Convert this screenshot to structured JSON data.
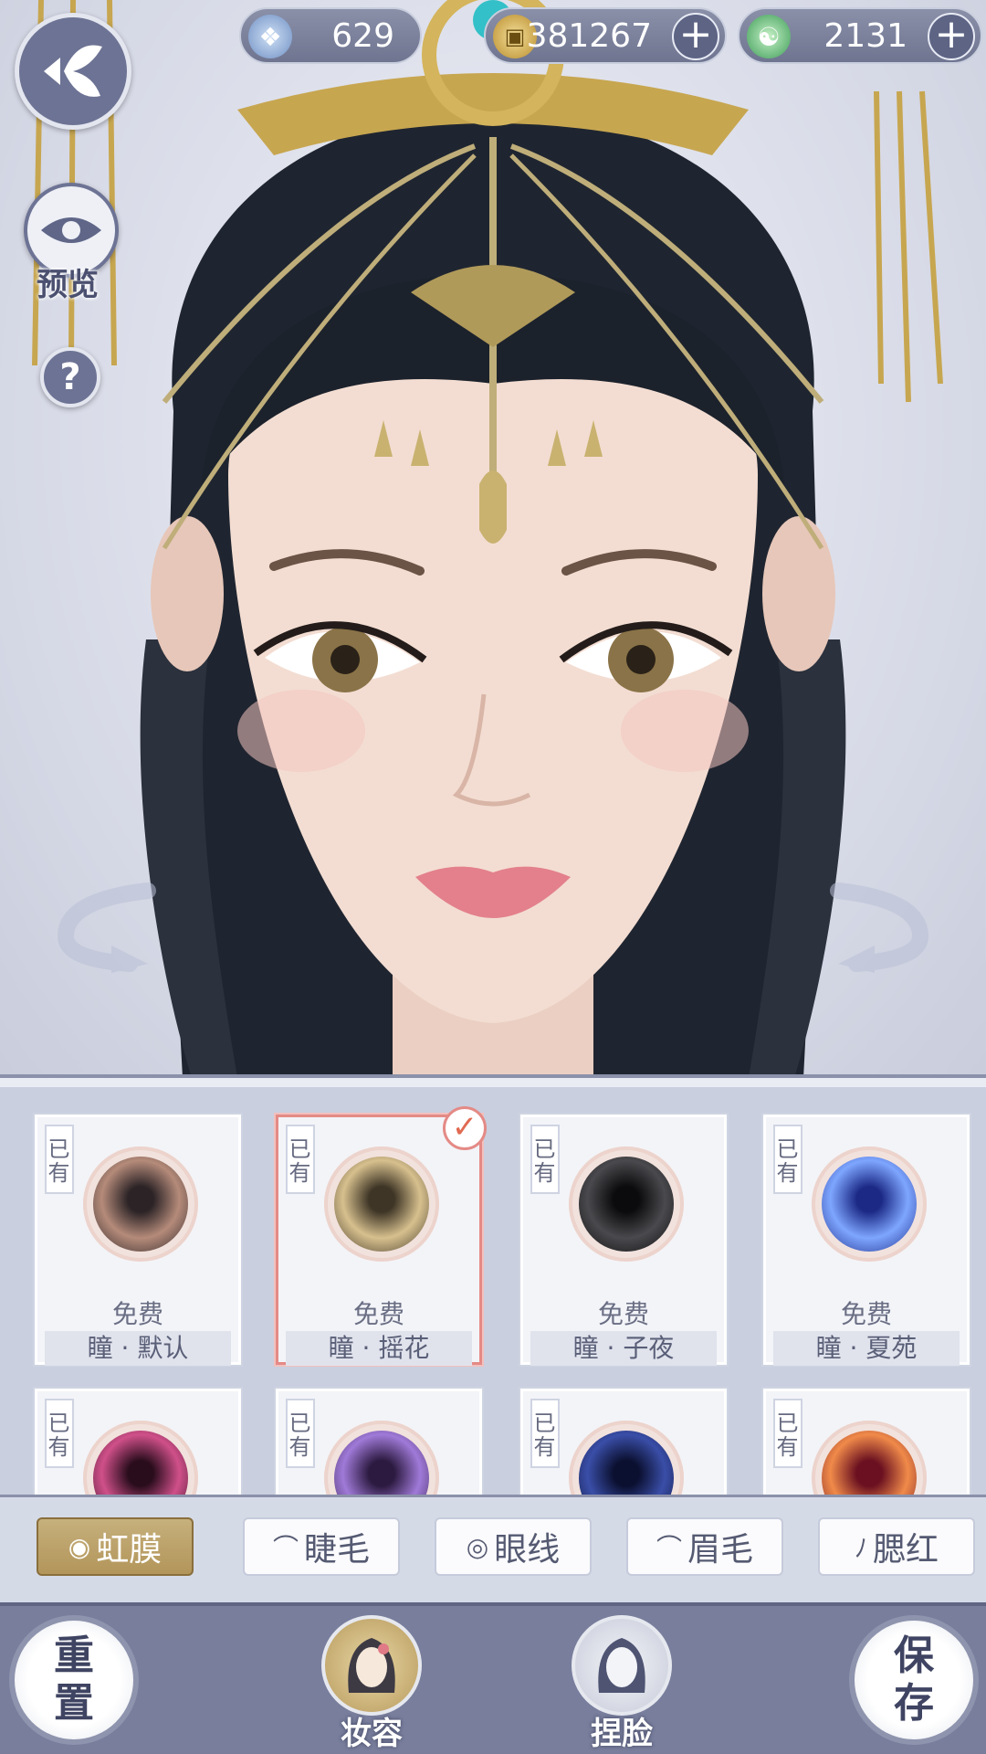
{
  "currencies": [
    {
      "icon": "jade-coin-icon",
      "value": "629"
    },
    {
      "icon": "gold-coin-icon",
      "value": "381267",
      "add": "+"
    },
    {
      "icon": "green-token-icon",
      "value": "2131",
      "add": "+"
    }
  ],
  "left_controls": {
    "back_icon": "back-butterfly-icon",
    "preview_label": "预览",
    "help_label": "?"
  },
  "items": [
    {
      "owned": "已有",
      "price": "免费",
      "name": "瞳 · 默认",
      "color_a": "#b58b7a",
      "color_b": "#2b2326",
      "selected": false
    },
    {
      "owned": "已有",
      "price": "免费",
      "name": "瞳 · 摇花",
      "color_a": "#d7c08e",
      "color_b": "#3e3526",
      "selected": true
    },
    {
      "owned": "已有",
      "price": "免费",
      "name": "瞳 · 子夜",
      "color_a": "#4a4a4e",
      "color_b": "#0b0b0d",
      "selected": false
    },
    {
      "owned": "已有",
      "price": "免费",
      "name": "瞳 · 夏苑",
      "color_a": "#7ea6ff",
      "color_b": "#1c2a86",
      "selected": false
    },
    {
      "owned": "已有",
      "price": "",
      "name": "",
      "color_a": "#d0508a",
      "color_b": "#2a0d1d",
      "selected": false
    },
    {
      "owned": "已有",
      "price": "",
      "name": "",
      "color_a": "#a07ad8",
      "color_b": "#2c1a40",
      "selected": false
    },
    {
      "owned": "已有",
      "price": "",
      "name": "",
      "color_a": "#3a4ea8",
      "color_b": "#0b1030",
      "selected": false
    },
    {
      "owned": "已有",
      "price": "",
      "name": "",
      "color_a": "#f08a4a",
      "color_b": "#6a1020",
      "selected": false
    }
  ],
  "tabs": [
    {
      "label": "虹膜",
      "icon": "◉",
      "active": true
    },
    {
      "label": "睫毛",
      "icon": "⌒",
      "active": false
    },
    {
      "label": "眼线",
      "icon": "◎",
      "active": false
    },
    {
      "label": "眉毛",
      "icon": "⌒",
      "active": false
    },
    {
      "label": "腮红",
      "icon": "ﾉ",
      "active": false
    }
  ],
  "bottom": {
    "reset": [
      "重",
      "置"
    ],
    "save": [
      "保",
      "存"
    ],
    "makeup_label": "妆容",
    "face_label": "捏脸"
  },
  "colors": {
    "accent_gold": "#b2955a",
    "selected_border": "#e48a86",
    "bar": "#787e9c"
  }
}
